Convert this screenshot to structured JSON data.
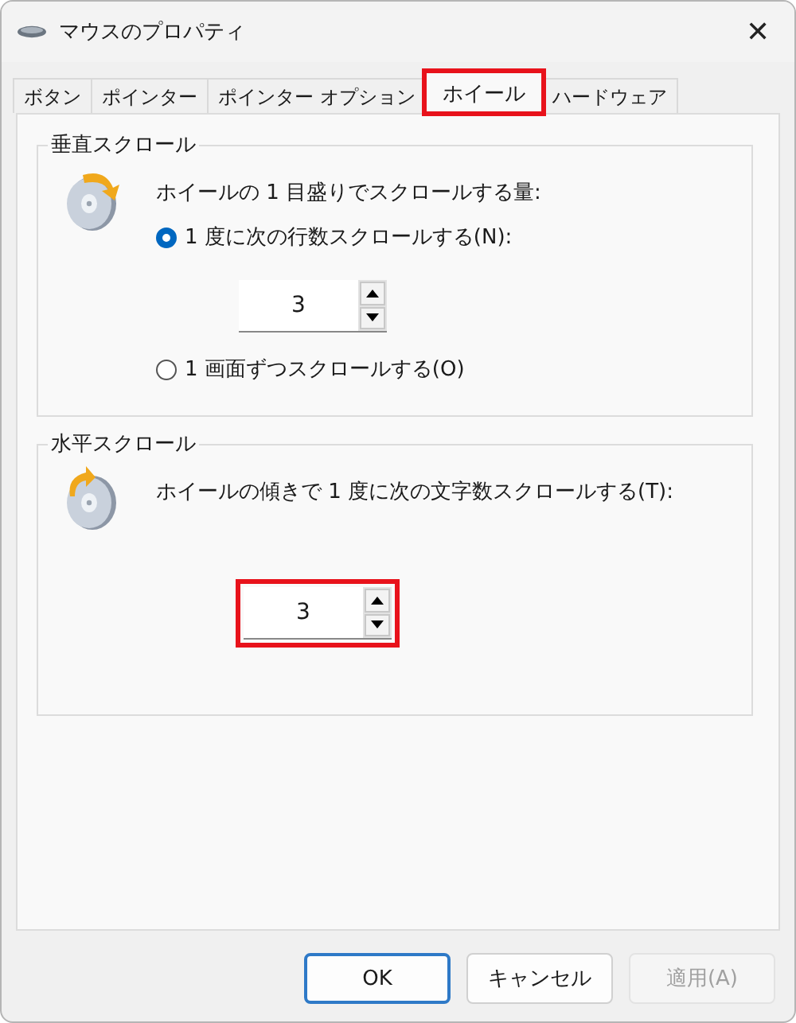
{
  "window": {
    "title": "マウスのプロパティ",
    "close": "✕"
  },
  "tabs": [
    {
      "label": "ボタン",
      "selected": false,
      "highlighted": false
    },
    {
      "label": "ポインター",
      "selected": false,
      "highlighted": false
    },
    {
      "label": "ポインター オプション",
      "selected": false,
      "highlighted": false
    },
    {
      "label": "ホイール",
      "selected": true,
      "highlighted": true
    },
    {
      "label": "ハードウェア",
      "selected": false,
      "highlighted": false
    }
  ],
  "vertical_scroll": {
    "title": "垂直スクロール",
    "prompt": "ホイールの 1 目盛りでスクロールする量:",
    "options": [
      {
        "label": "1 度に次の行数スクロールする(N):",
        "selected": true,
        "spinner": {
          "value": "3",
          "highlighted": false
        }
      },
      {
        "label": "1 画面ずつスクロールする(O)",
        "selected": false
      }
    ]
  },
  "horizontal_scroll": {
    "title": "水平スクロール",
    "prompt": "ホイールの傾きで 1 度に次の文字数スクロールする(T):",
    "spinner": {
      "value": "3",
      "highlighted": true
    }
  },
  "buttons": [
    {
      "label": "OK",
      "kind": "default",
      "disabled": false
    },
    {
      "label": "キャンセル",
      "kind": "normal",
      "disabled": false
    },
    {
      "label": "適用(A)",
      "kind": "normal",
      "disabled": true
    }
  ]
}
